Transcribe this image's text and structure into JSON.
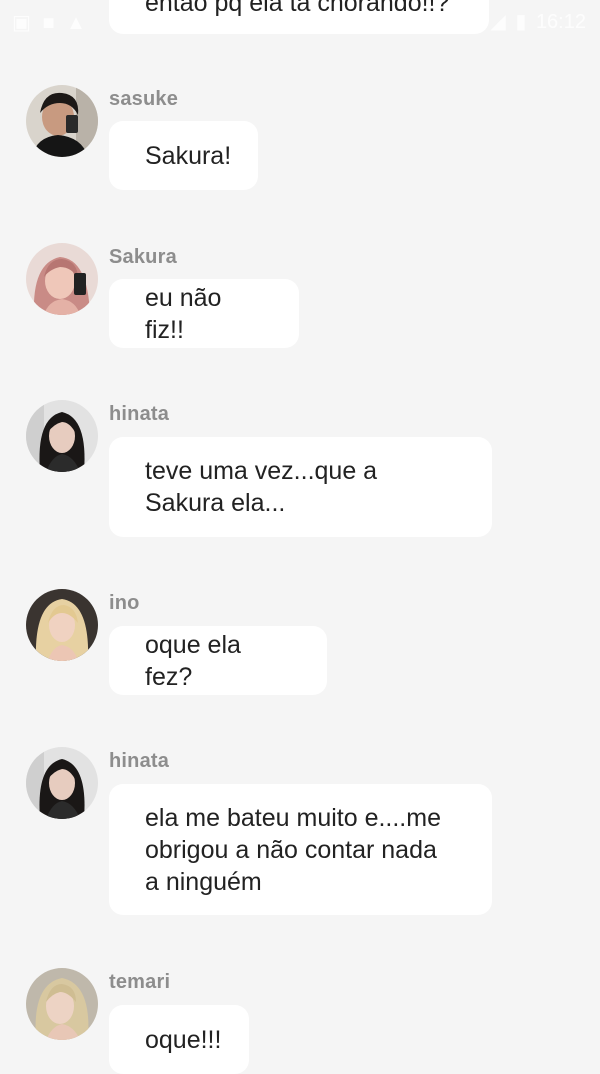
{
  "status_bar": {
    "time": "16:12",
    "icons": [
      "image-icon",
      "folder-icon",
      "warning-icon",
      "signal-icon",
      "battery-icon"
    ]
  },
  "messages": [
    {
      "sender": "",
      "text": "então pq ela tá chorando!!?",
      "avatar": "none"
    },
    {
      "sender": "sasuke",
      "text": "Sakura!",
      "avatar": "dark-haired-boy-photo"
    },
    {
      "sender": "Sakura",
      "text": "eu não fiz!!",
      "avatar": "pink-haired-girl-photo"
    },
    {
      "sender": "hinata",
      "text": "teve uma vez...que a\nSakura ela...",
      "avatar": "dark-haired-girl-photo"
    },
    {
      "sender": "ino",
      "text": "oque ela fez?",
      "avatar": "blonde-girl-photo"
    },
    {
      "sender": "hinata",
      "text": "ela me bateu muito e....me\nobrigou a não contar nada\na ninguém",
      "avatar": "dark-haired-girl-photo"
    },
    {
      "sender": "temari",
      "text": "oque!!!",
      "avatar": "light-blonde-girl-photo"
    }
  ],
  "colors": {
    "background": "#f5f5f5",
    "bubble": "#ffffff",
    "sender_name": "#8d8d8d",
    "message_text": "#222222"
  }
}
